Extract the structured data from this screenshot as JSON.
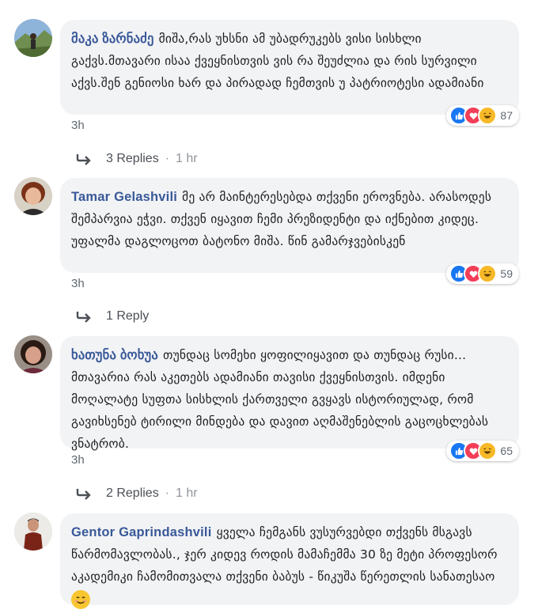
{
  "comments": [
    {
      "author": "მაკა ზარნაძე",
      "text": "მიშა,რას უხსნი ამ უბადრუკებს ვისი სისხლი გაქვს.მთავარი ისაა ქვეყნისთვის ვის რა შეუძლია და რის სურვილი აქვს.შენ გენიოსი ხარ და პირადად ჩემთვის უ პატრიოტესი ადამიანი",
      "reaction_count": "87",
      "time": "3h",
      "replies_label": "3 Replies",
      "replies_time": "1 hr"
    },
    {
      "author": "Tamar Gelashvili",
      "text": "მე არ მაინტერესებდა თქვენი ეროვნება. არასოდეს შემპარვია ეჭვი. თქვენ იყავით ჩემი პრეზიდენტი და იქნებით კიდეც. უფალმა დაგლოცოთ ბატონო მიშა. წინ გამარჯვებისკენ",
      "reaction_count": "59",
      "time": "3h",
      "replies_label": "1 Reply",
      "replies_time": ""
    },
    {
      "author": "ხათუნა ბოხუა",
      "text": "თუნდაც სომეხი ყოფილიყავით და თუნდაც რუსი... მთავარია რას აკეთებს ადამიანი თავისი ქვეყნისთვის. იმდენი მოღალატე სუფთა სისხლის ქართველი გვყავს ისტორიულად, რომ გავიხსენებ ტირილი მინდება და დავით აღმაშენებლის გაცოცხლებას ვნატრობ.",
      "reaction_count": "65",
      "time": "3h",
      "replies_label": "2 Replies",
      "replies_time": "1 hr"
    },
    {
      "author": "Gentor Gaprindashvili",
      "text": "ყველა ჩემგანს ვუსურვებდი თქვენს მსგავს წარმომავლობას., ჯერ კიდევ როდის მამაჩემმა 30 ზე მეტი პროფესორ აკადემიკი ჩამომითვალა თქვენი ბაბუს - წიკუშა წერეთლის სანათესაო",
      "emoji": "smile-emoji"
    }
  ],
  "colors": {
    "author": "#385898",
    "bubble": "#f2f3f5",
    "like": "#1877f2",
    "love": "#f33e58",
    "haha": "#f7b928"
  }
}
